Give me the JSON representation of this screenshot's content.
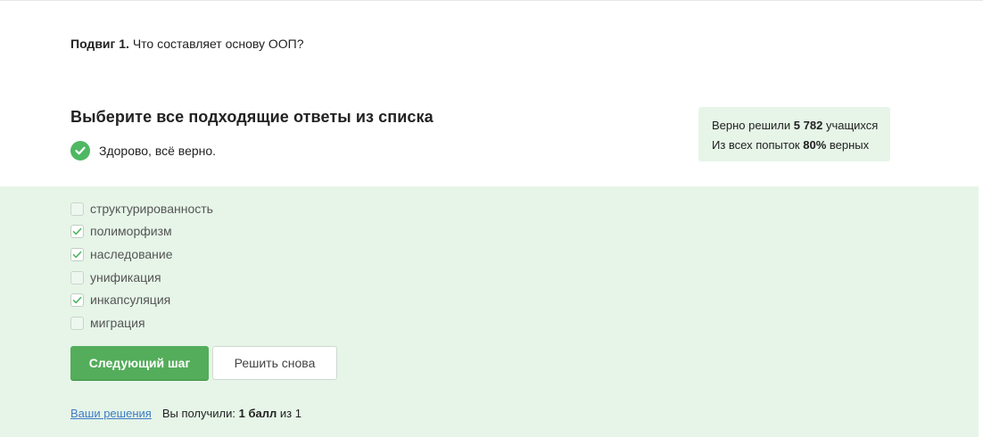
{
  "question": {
    "number_label": "Подвиг 1.",
    "text": "Что составляет основу ООП?"
  },
  "instruction": "Выберите все подходящие ответы из списка",
  "result": {
    "icon": "check-circle-icon",
    "text": "Здорово, всё верно."
  },
  "stats": {
    "line1_prefix": "Верно решили",
    "solved_count": "5 782",
    "line1_suffix": "учащихся",
    "line2_prefix": "Из всех попыток",
    "percent": "80%",
    "line2_suffix": "верных"
  },
  "options": [
    {
      "label": "структурированность",
      "checked": false
    },
    {
      "label": "полиморфизм",
      "checked": true
    },
    {
      "label": "наследование",
      "checked": true
    },
    {
      "label": "унификация",
      "checked": false
    },
    {
      "label": "инкапсуляция",
      "checked": true
    },
    {
      "label": "миграция",
      "checked": false
    }
  ],
  "buttons": {
    "next": "Следующий шаг",
    "retry": "Решить снова"
  },
  "footer": {
    "solutions_link": "Ваши решения",
    "received_prefix": "Вы получили:",
    "score": "1 балл",
    "score_suffix": "из 1"
  },
  "colors": {
    "accent_green": "#54ad5b",
    "success_bg": "#e6f5e8",
    "link_blue": "#3e7bc4"
  }
}
